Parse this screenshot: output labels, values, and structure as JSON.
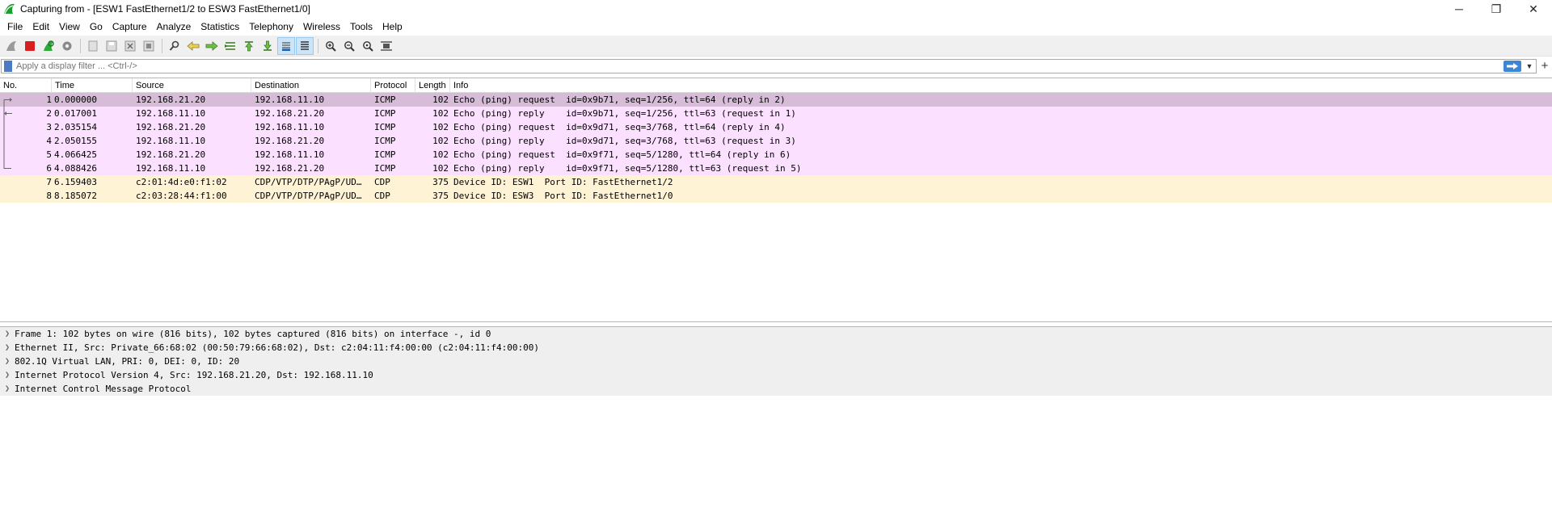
{
  "window": {
    "title": "Capturing from - [ESW1 FastEthernet1/2 to ESW3 FastEthernet1/0]",
    "minimize": "─",
    "restore": "❐",
    "close": "✕"
  },
  "menu": [
    "File",
    "Edit",
    "View",
    "Go",
    "Capture",
    "Analyze",
    "Statistics",
    "Telephony",
    "Wireless",
    "Tools",
    "Help"
  ],
  "toolbar": {
    "icons": [
      "shark-fin-icon",
      "stop-capture-icon",
      "restart-capture-icon",
      "capture-options-icon",
      "open-file-icon",
      "save-file-icon",
      "close-file-icon",
      "reload-file-icon",
      "find-packet-icon",
      "go-back-icon",
      "go-forward-icon",
      "go-to-packet-icon",
      "go-first-icon",
      "go-last-icon",
      "autoscroll-icon",
      "colorize-icon",
      "zoom-in-icon",
      "zoom-out-icon",
      "normal-size-icon",
      "resize-columns-icon"
    ]
  },
  "filter": {
    "placeholder": "Apply a display filter ... <Ctrl-/>",
    "value": ""
  },
  "columns": [
    "No.",
    "Time",
    "Source",
    "Destination",
    "Protocol",
    "Length",
    "Info"
  ],
  "packets": [
    {
      "no": "1",
      "time": "0.000000",
      "src": "192.168.21.20",
      "dst": "192.168.11.10",
      "proto": "ICMP",
      "len": "102",
      "info": "Echo (ping) request  id=0x9b71, seq=1/256, ttl=64 (reply in 2)"
    },
    {
      "no": "2",
      "time": "0.017001",
      "src": "192.168.11.10",
      "dst": "192.168.21.20",
      "proto": "ICMP",
      "len": "102",
      "info": "Echo (ping) reply    id=0x9b71, seq=1/256, ttl=63 (request in 1)"
    },
    {
      "no": "3",
      "time": "2.035154",
      "src": "192.168.21.20",
      "dst": "192.168.11.10",
      "proto": "ICMP",
      "len": "102",
      "info": "Echo (ping) request  id=0x9d71, seq=3/768, ttl=64 (reply in 4)"
    },
    {
      "no": "4",
      "time": "2.050155",
      "src": "192.168.11.10",
      "dst": "192.168.21.20",
      "proto": "ICMP",
      "len": "102",
      "info": "Echo (ping) reply    id=0x9d71, seq=3/768, ttl=63 (request in 3)"
    },
    {
      "no": "5",
      "time": "4.066425",
      "src": "192.168.21.20",
      "dst": "192.168.11.10",
      "proto": "ICMP",
      "len": "102",
      "info": "Echo (ping) request  id=0x9f71, seq=5/1280, ttl=64 (reply in 6)"
    },
    {
      "no": "6",
      "time": "4.088426",
      "src": "192.168.11.10",
      "dst": "192.168.21.20",
      "proto": "ICMP",
      "len": "102",
      "info": "Echo (ping) reply    id=0x9f71, seq=5/1280, ttl=63 (request in 5)"
    },
    {
      "no": "7",
      "time": "6.159403",
      "src": "c2:01:4d:e0:f1:02",
      "dst": "CDP/VTP/DTP/PAgP/UD…",
      "proto": "CDP",
      "len": "375",
      "info": "Device ID: ESW1  Port ID: FastEthernet1/2"
    },
    {
      "no": "8",
      "time": "8.185072",
      "src": "c2:03:28:44:f1:00",
      "dst": "CDP/VTP/DTP/PAgP/UD…",
      "proto": "CDP",
      "len": "375",
      "info": "Device ID: ESW3  Port ID: FastEthernet1/0"
    }
  ],
  "details": [
    "Frame 1: 102 bytes on wire (816 bits), 102 bytes captured (816 bits) on interface -, id 0",
    "Ethernet II, Src: Private_66:68:02 (00:50:79:66:68:02), Dst: c2:04:11:f4:00:00 (c2:04:11:f4:00:00)",
    "802.1Q Virtual LAN, PRI: 0, DEI: 0, ID: 20",
    "Internet Protocol Version 4, Src: 192.168.21.20, Dst: 192.168.11.10",
    "Internet Control Message Protocol"
  ],
  "colors": {
    "icmp_row": "#fce0ff",
    "selected_row": "#d6bcd6",
    "cdp_row": "#fff3d6"
  }
}
